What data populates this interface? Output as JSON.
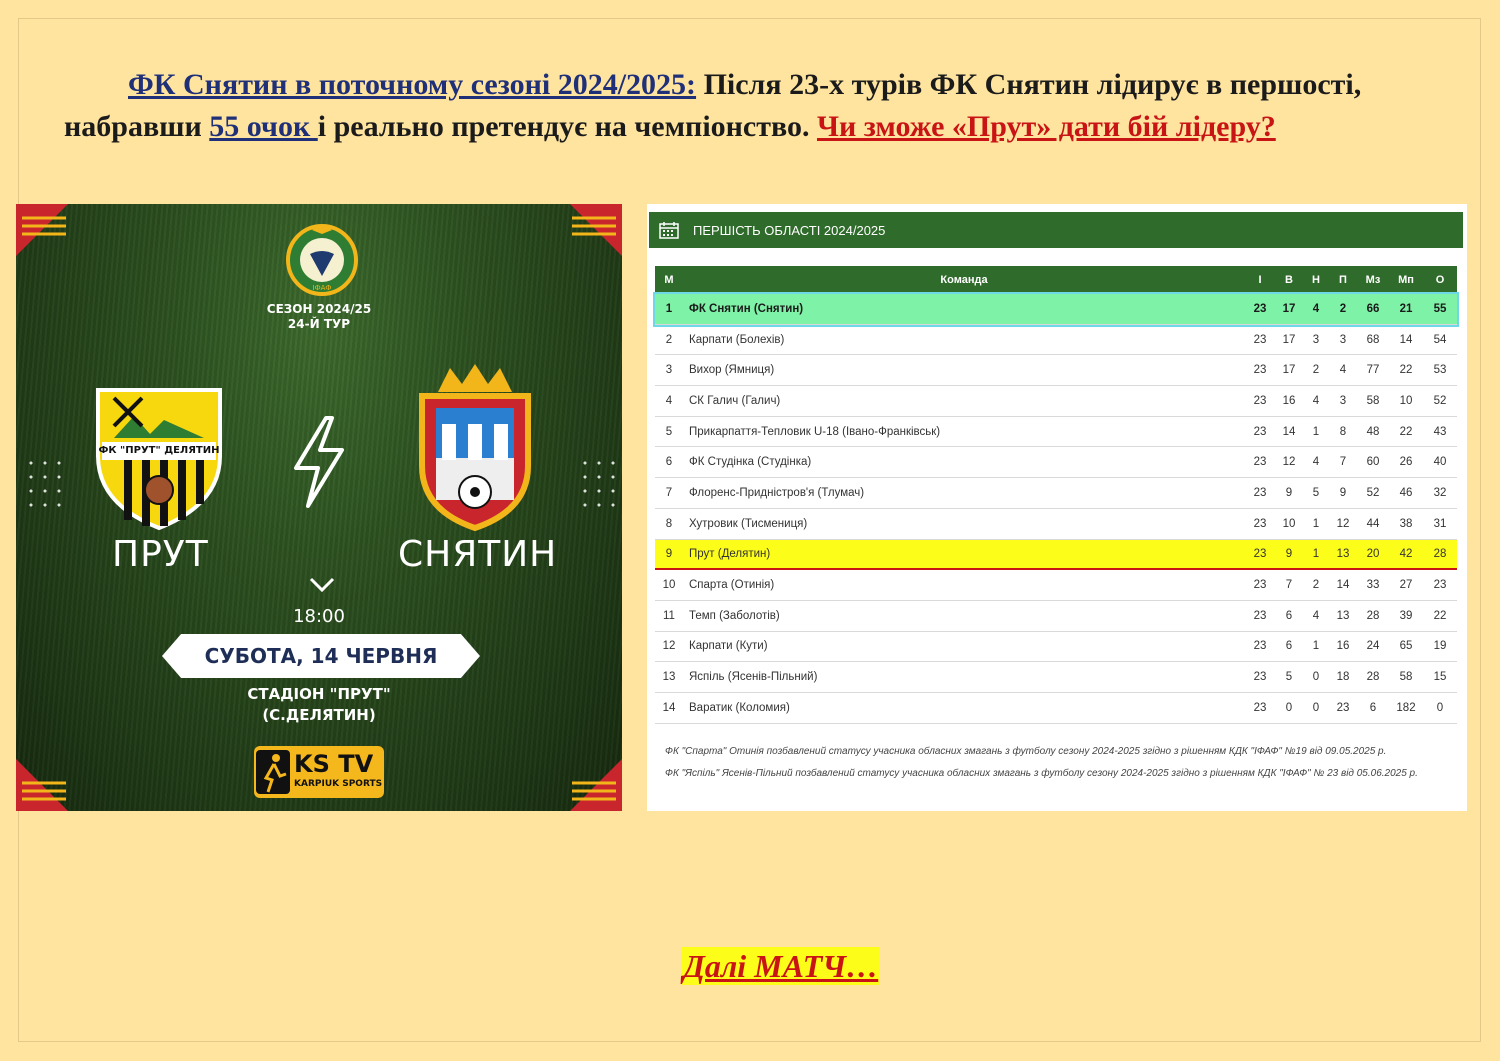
{
  "intro": {
    "lead_link": "ФК Снятин в поточному сезоні 2024/2025:",
    "text1": " Після 23-х турів ФК Снятин лідирує в першості, набравши ",
    "points_link": "55 очок ",
    "text2": "і реально претендує на чемпіонство. ",
    "question_link": "Чи зможе «Прут» дати бій лідеру?"
  },
  "poster": {
    "season": "СЕЗОН 2024/25",
    "round": "24-Й ТУР",
    "federation_emblem": "ІФАФ",
    "home_crest_text": "ФК \"ПРУТ\" ДЕЛЯТИН",
    "home_team": "ПРУТ",
    "away_team": "СНЯТИН",
    "time": "18:00",
    "date": "СУБОТА, 14 ЧЕРВНЯ",
    "stadium_line1": "СТАДІОН \"ПРУТ\"",
    "stadium_line2": "(С.ДЕЛЯТИН)",
    "broadcaster": "KS TV",
    "broadcaster_sub": "KARPIUK SPORTS",
    "colors": {
      "accent_red": "#c8262c",
      "accent_gold": "#f2b51a",
      "grass": "#2a4d1e"
    }
  },
  "standings": {
    "title": "ПЕРШІСТЬ ОБЛАСТІ 2024/2025",
    "headers": {
      "pos": "М",
      "team": "Команда",
      "g": "І",
      "w": "В",
      "d": "Н",
      "l": "П",
      "gf": "Мз",
      "ga": "Мп",
      "pts": "О"
    },
    "rows": [
      {
        "pos": "1",
        "team": "ФК Снятин (Снятин)",
        "g": "23",
        "w": "17",
        "d": "4",
        "l": "2",
        "gf": "66",
        "ga": "21",
        "pts": "55"
      },
      {
        "pos": "2",
        "team": "Карпати (Болехів)",
        "g": "23",
        "w": "17",
        "d": "3",
        "l": "3",
        "gf": "68",
        "ga": "14",
        "pts": "54"
      },
      {
        "pos": "3",
        "team": "Вихор (Ямниця)",
        "g": "23",
        "w": "17",
        "d": "2",
        "l": "4",
        "gf": "77",
        "ga": "22",
        "pts": "53"
      },
      {
        "pos": "4",
        "team": "СК Галич (Галич)",
        "g": "23",
        "w": "16",
        "d": "4",
        "l": "3",
        "gf": "58",
        "ga": "10",
        "pts": "52"
      },
      {
        "pos": "5",
        "team": "Прикарпаття-Теплoвик U-18 (Івано-Франківськ)",
        "g": "23",
        "w": "14",
        "d": "1",
        "l": "8",
        "gf": "48",
        "ga": "22",
        "pts": "43"
      },
      {
        "pos": "6",
        "team": "ФК Студінка (Студінка)",
        "g": "23",
        "w": "12",
        "d": "4",
        "l": "7",
        "gf": "60",
        "ga": "26",
        "pts": "40"
      },
      {
        "pos": "7",
        "team": "Флоренс-Придністров'я (Тлумач)",
        "g": "23",
        "w": "9",
        "d": "5",
        "l": "9",
        "gf": "52",
        "ga": "46",
        "pts": "32"
      },
      {
        "pos": "8",
        "team": "Хутровик (Тисмениця)",
        "g": "23",
        "w": "10",
        "d": "1",
        "l": "12",
        "gf": "44",
        "ga": "38",
        "pts": "31"
      },
      {
        "pos": "9",
        "team": "Прут (Делятин)",
        "g": "23",
        "w": "9",
        "d": "1",
        "l": "13",
        "gf": "20",
        "ga": "42",
        "pts": "28"
      },
      {
        "pos": "10",
        "team": "Спарта (Отинія)",
        "g": "23",
        "w": "7",
        "d": "2",
        "l": "14",
        "gf": "33",
        "ga": "27",
        "pts": "23"
      },
      {
        "pos": "11",
        "team": "Темп (Заболотів)",
        "g": "23",
        "w": "6",
        "d": "4",
        "l": "13",
        "gf": "28",
        "ga": "39",
        "pts": "22"
      },
      {
        "pos": "12",
        "team": "Карпати (Кути)",
        "g": "23",
        "w": "6",
        "d": "1",
        "l": "16",
        "gf": "24",
        "ga": "65",
        "pts": "19"
      },
      {
        "pos": "13",
        "team": "Яспіль (Ясенів-Пільний)",
        "g": "23",
        "w": "5",
        "d": "0",
        "l": "18",
        "gf": "28",
        "ga": "58",
        "pts": "15"
      },
      {
        "pos": "14",
        "team": "Варатик (Коломия)",
        "g": "23",
        "w": "0",
        "d": "0",
        "l": "23",
        "gf": "6",
        "ga": "182",
        "pts": "0"
      }
    ],
    "note1": "ФК \"Спарта\" Отинія позбавлений статусу учасника обласних змагань з футболу сезону 2024-2025 згідно з рішенням КДК \"ІФАФ\" №19 від 09.05.2025 р.",
    "note2": "ФК \"Яспіль\" Ясенів-Пільний позбавлений статусу учасника обласних змагань з футболу сезону 2024-2025 згідно з рішенням КДК \"ІФАФ\" № 23 від 05.06.2025 р.",
    "colors": {
      "header_green": "#2f6b2b",
      "leader_highlight": "#7ef2a7",
      "team_highlight": "#fdfd1a"
    }
  },
  "footer": {
    "next": "Далі МАТЧ…"
  }
}
